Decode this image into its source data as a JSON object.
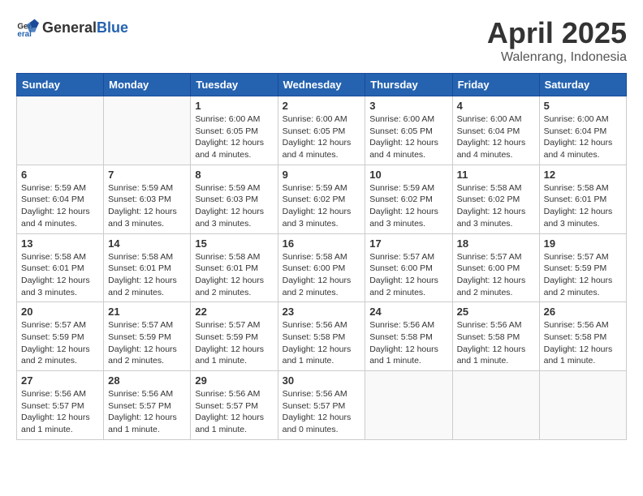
{
  "header": {
    "logo_general": "General",
    "logo_blue": "Blue",
    "month_title": "April 2025",
    "location": "Walenrang, Indonesia"
  },
  "days_of_week": [
    "Sunday",
    "Monday",
    "Tuesday",
    "Wednesday",
    "Thursday",
    "Friday",
    "Saturday"
  ],
  "weeks": [
    [
      {
        "day": "",
        "detail": ""
      },
      {
        "day": "",
        "detail": ""
      },
      {
        "day": "1",
        "detail": "Sunrise: 6:00 AM\nSunset: 6:05 PM\nDaylight: 12 hours\nand 4 minutes."
      },
      {
        "day": "2",
        "detail": "Sunrise: 6:00 AM\nSunset: 6:05 PM\nDaylight: 12 hours\nand 4 minutes."
      },
      {
        "day": "3",
        "detail": "Sunrise: 6:00 AM\nSunset: 6:05 PM\nDaylight: 12 hours\nand 4 minutes."
      },
      {
        "day": "4",
        "detail": "Sunrise: 6:00 AM\nSunset: 6:04 PM\nDaylight: 12 hours\nand 4 minutes."
      },
      {
        "day": "5",
        "detail": "Sunrise: 6:00 AM\nSunset: 6:04 PM\nDaylight: 12 hours\nand 4 minutes."
      }
    ],
    [
      {
        "day": "6",
        "detail": "Sunrise: 5:59 AM\nSunset: 6:04 PM\nDaylight: 12 hours\nand 4 minutes."
      },
      {
        "day": "7",
        "detail": "Sunrise: 5:59 AM\nSunset: 6:03 PM\nDaylight: 12 hours\nand 3 minutes."
      },
      {
        "day": "8",
        "detail": "Sunrise: 5:59 AM\nSunset: 6:03 PM\nDaylight: 12 hours\nand 3 minutes."
      },
      {
        "day": "9",
        "detail": "Sunrise: 5:59 AM\nSunset: 6:02 PM\nDaylight: 12 hours\nand 3 minutes."
      },
      {
        "day": "10",
        "detail": "Sunrise: 5:59 AM\nSunset: 6:02 PM\nDaylight: 12 hours\nand 3 minutes."
      },
      {
        "day": "11",
        "detail": "Sunrise: 5:58 AM\nSunset: 6:02 PM\nDaylight: 12 hours\nand 3 minutes."
      },
      {
        "day": "12",
        "detail": "Sunrise: 5:58 AM\nSunset: 6:01 PM\nDaylight: 12 hours\nand 3 minutes."
      }
    ],
    [
      {
        "day": "13",
        "detail": "Sunrise: 5:58 AM\nSunset: 6:01 PM\nDaylight: 12 hours\nand 3 minutes."
      },
      {
        "day": "14",
        "detail": "Sunrise: 5:58 AM\nSunset: 6:01 PM\nDaylight: 12 hours\nand 2 minutes."
      },
      {
        "day": "15",
        "detail": "Sunrise: 5:58 AM\nSunset: 6:01 PM\nDaylight: 12 hours\nand 2 minutes."
      },
      {
        "day": "16",
        "detail": "Sunrise: 5:58 AM\nSunset: 6:00 PM\nDaylight: 12 hours\nand 2 minutes."
      },
      {
        "day": "17",
        "detail": "Sunrise: 5:57 AM\nSunset: 6:00 PM\nDaylight: 12 hours\nand 2 minutes."
      },
      {
        "day": "18",
        "detail": "Sunrise: 5:57 AM\nSunset: 6:00 PM\nDaylight: 12 hours\nand 2 minutes."
      },
      {
        "day": "19",
        "detail": "Sunrise: 5:57 AM\nSunset: 5:59 PM\nDaylight: 12 hours\nand 2 minutes."
      }
    ],
    [
      {
        "day": "20",
        "detail": "Sunrise: 5:57 AM\nSunset: 5:59 PM\nDaylight: 12 hours\nand 2 minutes."
      },
      {
        "day": "21",
        "detail": "Sunrise: 5:57 AM\nSunset: 5:59 PM\nDaylight: 12 hours\nand 2 minutes."
      },
      {
        "day": "22",
        "detail": "Sunrise: 5:57 AM\nSunset: 5:59 PM\nDaylight: 12 hours\nand 1 minute."
      },
      {
        "day": "23",
        "detail": "Sunrise: 5:56 AM\nSunset: 5:58 PM\nDaylight: 12 hours\nand 1 minute."
      },
      {
        "day": "24",
        "detail": "Sunrise: 5:56 AM\nSunset: 5:58 PM\nDaylight: 12 hours\nand 1 minute."
      },
      {
        "day": "25",
        "detail": "Sunrise: 5:56 AM\nSunset: 5:58 PM\nDaylight: 12 hours\nand 1 minute."
      },
      {
        "day": "26",
        "detail": "Sunrise: 5:56 AM\nSunset: 5:58 PM\nDaylight: 12 hours\nand 1 minute."
      }
    ],
    [
      {
        "day": "27",
        "detail": "Sunrise: 5:56 AM\nSunset: 5:57 PM\nDaylight: 12 hours\nand 1 minute."
      },
      {
        "day": "28",
        "detail": "Sunrise: 5:56 AM\nSunset: 5:57 PM\nDaylight: 12 hours\nand 1 minute."
      },
      {
        "day": "29",
        "detail": "Sunrise: 5:56 AM\nSunset: 5:57 PM\nDaylight: 12 hours\nand 1 minute."
      },
      {
        "day": "30",
        "detail": "Sunrise: 5:56 AM\nSunset: 5:57 PM\nDaylight: 12 hours\nand 0 minutes."
      },
      {
        "day": "",
        "detail": ""
      },
      {
        "day": "",
        "detail": ""
      },
      {
        "day": "",
        "detail": ""
      }
    ]
  ]
}
